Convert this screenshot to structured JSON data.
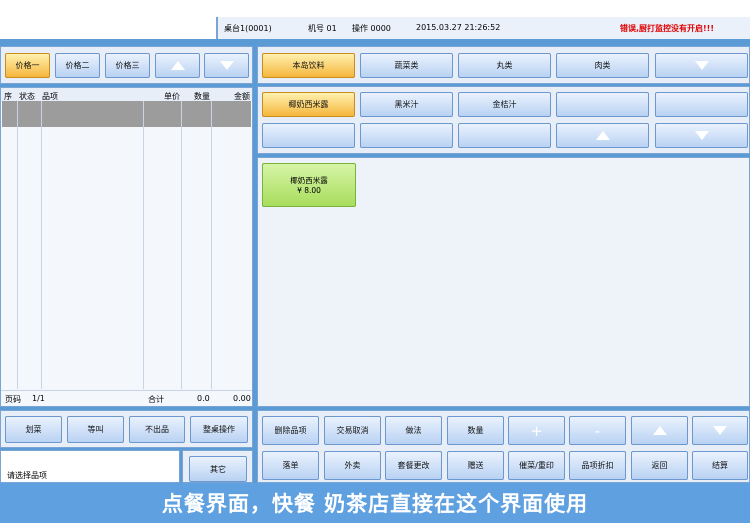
{
  "header": {
    "table": "桌台1(0001)",
    "machine": "机号 01",
    "operator": "操作 0000",
    "datetime": "2015.03.27 21:26:52",
    "warning": "错误,厨打监控没有开启!!!"
  },
  "price_tabs": [
    "价格一",
    "价格二",
    "价格三"
  ],
  "order_table": {
    "columns": [
      "序",
      "状态",
      "品项",
      "单价",
      "数量",
      "金额"
    ],
    "page_label": "页码",
    "page_value": "1/1",
    "total_label": "合计",
    "total_qty": "0.0",
    "total_amount": "0.00"
  },
  "left_actions": [
    "划菜",
    "等叫",
    "不出品",
    "整桌操作"
  ],
  "status_hint": "请选择品项",
  "other_button": "其它",
  "categories": [
    "本岛饮料",
    "蔬菜类",
    "丸类",
    "肉类"
  ],
  "subcategories": [
    "椰奶西米露",
    "黑米汁",
    "金桔汁"
  ],
  "product": {
    "name": "椰奶西米露",
    "price": "¥ 8.00"
  },
  "bottom_row1": [
    "删除品项",
    "交易取消",
    "做法",
    "数量"
  ],
  "bottom_row2": [
    "落单",
    "外卖",
    "套餐更改",
    "赠送",
    "催菜/重印",
    "品项折扣",
    "返回",
    "结算"
  ],
  "bottom_symbols": {
    "plus": "+",
    "minus": "-"
  },
  "banner": "点餐界面，快餐 奶茶店直接在这个界面使用",
  "colors": {
    "accent_orange": "#f5b63c",
    "product_green": "#a8dd5c",
    "warning_red": "#e00000",
    "banner_blue": "#5fa0e0"
  }
}
